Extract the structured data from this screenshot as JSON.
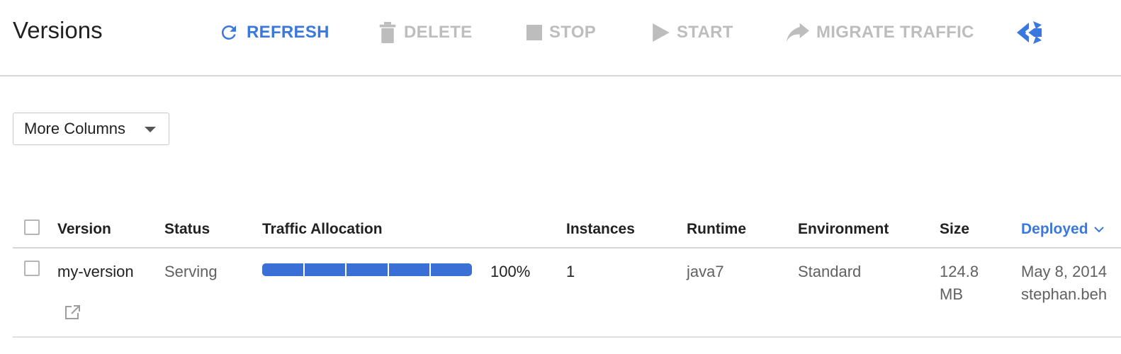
{
  "header": {
    "title": "Versions",
    "actions": {
      "refresh": "REFRESH",
      "delete": "DELETE",
      "stop": "STOP",
      "start": "START",
      "migrate": "MIGRATE TRAFFIC"
    }
  },
  "toolbar": {
    "more_columns": "More Columns"
  },
  "table": {
    "columns": {
      "version": "Version",
      "status": "Status",
      "traffic": "Traffic Allocation",
      "instances": "Instances",
      "runtime": "Runtime",
      "environment": "Environment",
      "size": "Size",
      "deployed": "Deployed"
    },
    "rows": [
      {
        "version": "my-version",
        "status": "Serving",
        "traffic_allocation": 1.0,
        "traffic_label": "100%",
        "instances": "1",
        "runtime": "java7",
        "environment": "Standard",
        "size": "124.8 MB",
        "deployed_date": "May 8, 2014",
        "deployed_by": "stephan.beh"
      }
    ]
  },
  "colors": {
    "accent": "#3a78e0",
    "disabled": "#bdbdbd",
    "traffic_bar": "#3a6fd6"
  },
  "icons": {
    "refresh": "refresh-icon",
    "delete": "trash-icon",
    "stop": "stop-icon",
    "start": "play-icon",
    "migrate": "forward-arrow-icon",
    "share": "share-icon",
    "external": "external-link-icon",
    "dropdown": "caret-down-icon",
    "sort": "chevron-down-icon"
  }
}
